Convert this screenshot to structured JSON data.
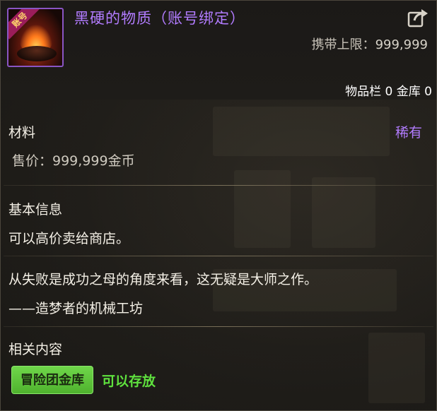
{
  "item": {
    "icon_name": "burning-coal-icon",
    "badge": "账号",
    "title": "黑硬的物质（账号绑定）",
    "title_color": "#b27cff",
    "carry_limit_label": "携带上限：",
    "carry_limit_value": "999,999",
    "inventory_label": "物品栏",
    "inventory_count": "0",
    "vault_label": "金库",
    "vault_count": "0",
    "storage_line": "物品栏 0 金库 0"
  },
  "category": {
    "type": "材料",
    "rarity": "稀有",
    "rarity_color": "#b27cff",
    "price": "售价：999,999金币"
  },
  "basic_info": {
    "heading": "基本信息",
    "description": "可以高价卖给商店。"
  },
  "flavor": {
    "line1": "从失败是成功之母的角度来看，这无疑是大师之作。",
    "line2": "——造梦者的机械工坊"
  },
  "related": {
    "heading": "相关内容",
    "tag": "冒险团金库",
    "status": "可以存放",
    "status_color": "#5fe23e"
  }
}
